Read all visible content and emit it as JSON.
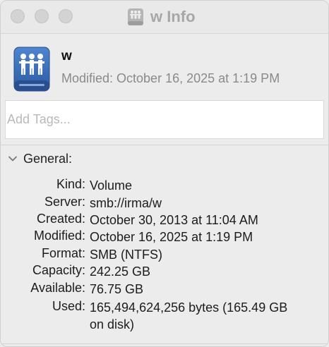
{
  "window": {
    "title": "w Info",
    "title_icon": "network-volume-icon"
  },
  "header": {
    "name": "w",
    "modified": "Modified: October 16, 2025 at 1:19 PM",
    "icon": "network-volume-icon"
  },
  "tags": {
    "placeholder": "Add Tags...",
    "value": ""
  },
  "general": {
    "label": "General:",
    "rows": [
      {
        "key": "Kind:",
        "value": "Volume"
      },
      {
        "key": "Server:",
        "value": "smb://irma/w"
      },
      {
        "key": "Created:",
        "value": "October 30, 2013 at 11:04 AM"
      },
      {
        "key": "Modified:",
        "value": "October 16, 2025 at 1:19 PM"
      },
      {
        "key": "Format:",
        "value": "SMB (NTFS)"
      },
      {
        "key": "Capacity:",
        "value": "242.25 GB"
      },
      {
        "key": "Available:",
        "value": "76.75 GB"
      },
      {
        "key": "Used:",
        "value": "165,494,624,256 bytes (165.49 GB on disk)"
      }
    ]
  },
  "colors": {
    "window_bg": "#ececec",
    "title_text": "#a7a7a7",
    "icon_blue": "#3a6db5",
    "secondary_text": "#8a8a8a"
  }
}
